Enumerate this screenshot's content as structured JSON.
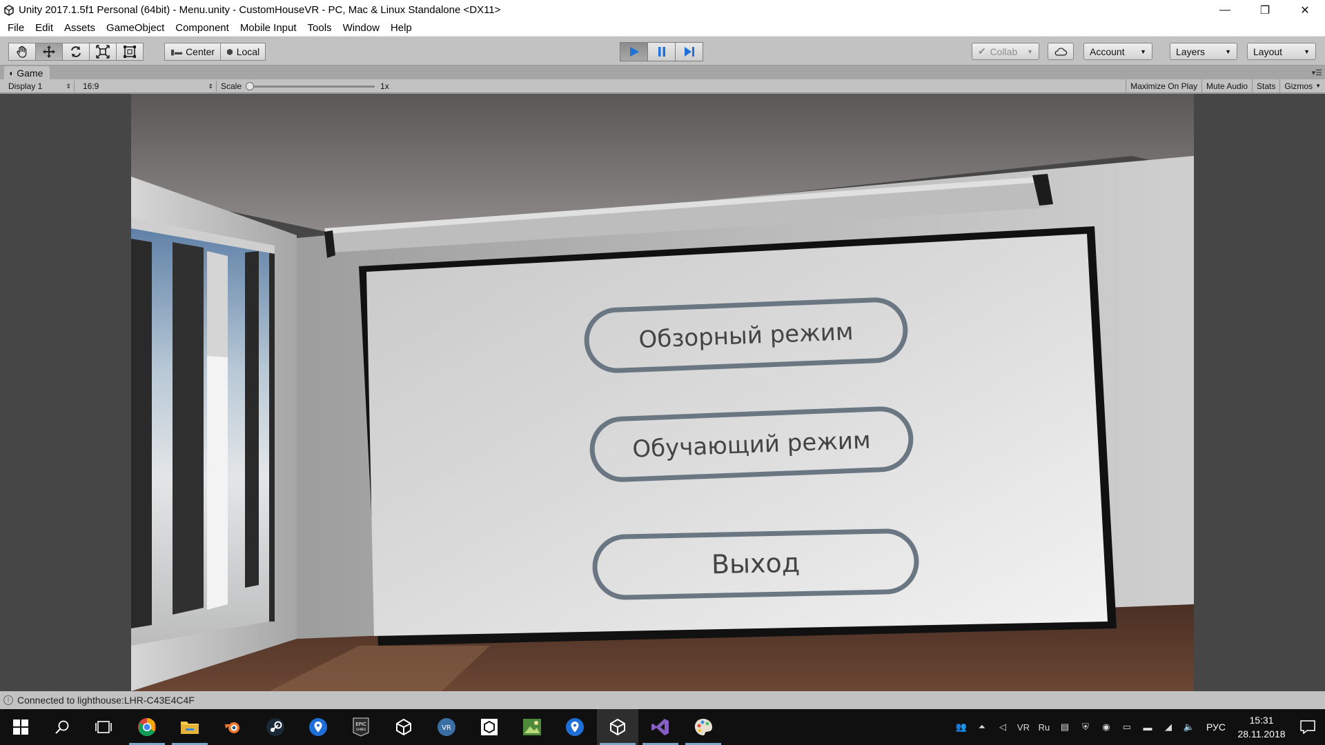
{
  "window": {
    "title": "Unity 2017.1.5f1 Personal (64bit) - Menu.unity - CustomHouseVR - PC, Mac & Linux Standalone <DX11>",
    "minimize": "—",
    "restore": "❐",
    "close": "✕"
  },
  "menu": [
    "File",
    "Edit",
    "Assets",
    "GameObject",
    "Component",
    "Mobile Input",
    "Tools",
    "Window",
    "Help"
  ],
  "toolbar": {
    "pivot_center": "Center",
    "pivot_local": "Local",
    "collab": "Collab",
    "account": "Account",
    "layers": "Layers",
    "layout": "Layout"
  },
  "game_tab": {
    "label": "Game",
    "display": "Display 1",
    "aspect": "16:9",
    "scale_label": "Scale",
    "scale_value": "1x",
    "maximize": "Maximize On Play",
    "mute": "Mute Audio",
    "stats": "Stats",
    "gizmos": "Gizmos"
  },
  "scene": {
    "buttons": [
      "Обзорный режим",
      "Обучающий режим",
      "Выход"
    ]
  },
  "status": {
    "message": "Connected to lighthouse:LHR-C43E4C4F"
  },
  "taskbar": {
    "language": "РУС",
    "time": "15:31",
    "date": "28.11.2018"
  }
}
